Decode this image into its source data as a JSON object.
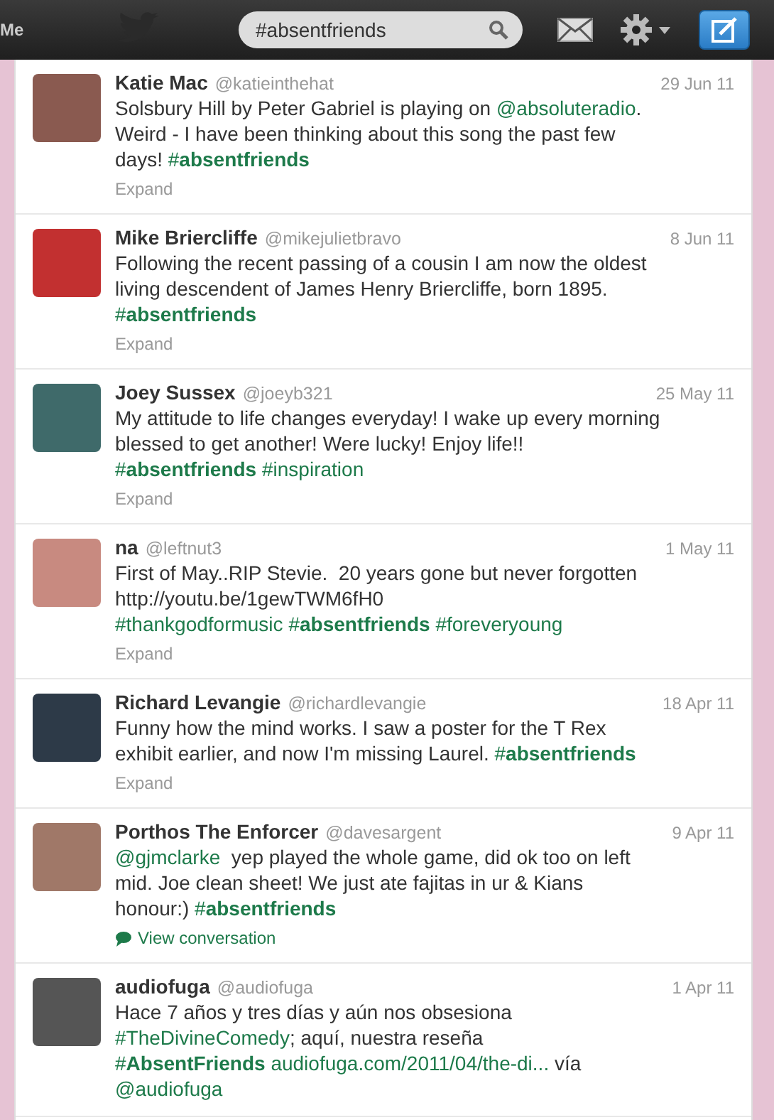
{
  "topbar": {
    "me_label": "Me",
    "search": {
      "value": "#absentfriends"
    }
  },
  "tweets": [
    {
      "name": "Katie Mac",
      "handle": "@katieinthehat",
      "date": "29 Jun 11",
      "body": [
        {
          "kind": "text",
          "text": "Solsbury Hill by Peter Gabriel is playing on "
        },
        {
          "kind": "mention",
          "text": "@absoluteradio"
        },
        {
          "kind": "text",
          "text": ". Weird - I have been thinking about this song the past few days! "
        },
        {
          "kind": "hashtag",
          "text": "#**absentfriends**"
        }
      ],
      "footer": {
        "kind": "expand",
        "text": "Expand"
      }
    },
    {
      "name": "Mike Briercliffe",
      "handle": "@mikejulietbravo",
      "date": "8 Jun 11",
      "body": [
        {
          "kind": "text",
          "text": "Following the recent passing of a cousin I am now the oldest living descendent of James Henry Briercliffe, born 1895. "
        },
        {
          "kind": "hashtag",
          "text": "#**absentfriends**"
        }
      ],
      "footer": {
        "kind": "expand",
        "text": "Expand"
      }
    },
    {
      "name": "Joey Sussex",
      "handle": "@joeyb321",
      "date": "25 May 11",
      "body": [
        {
          "kind": "text",
          "text": "My attitude to life changes everyday! I wake up every morning blessed to get another! Were lucky! Enjoy life!! "
        },
        {
          "kind": "hashtag",
          "text": "#**absentfriends** "
        },
        {
          "kind": "hashtag",
          "text": "#inspiration"
        }
      ],
      "footer": {
        "kind": "expand",
        "text": "Expand"
      }
    },
    {
      "name": "na",
      "handle": "@leftnut3",
      "date": "1 May 11",
      "body": [
        {
          "kind": "text",
          "text": "First of May..RIP Stevie.  20 years gone but never forgotten http://youtu.be/1gewTWM6fH0   "
        },
        {
          "kind": "hashtag",
          "text": "#thankgodformusic  "
        },
        {
          "kind": "hashtag",
          "text": "#**absentfriends** "
        },
        {
          "kind": "hashtag",
          "text": "#foreveryoung"
        }
      ],
      "footer": {
        "kind": "expand",
        "text": "Expand"
      }
    },
    {
      "name": "Richard Levangie",
      "handle": "@richardlevangie",
      "date": "18 Apr 11",
      "body": [
        {
          "kind": "text",
          "text": "Funny how the mind works. I saw a poster for the T Rex exhibit earlier, and now I'm missing Laurel. "
        },
        {
          "kind": "hashtag",
          "text": "#**absentfriends**"
        }
      ],
      "footer": {
        "kind": "expand",
        "text": "Expand"
      }
    },
    {
      "name": "Porthos The Enforcer",
      "handle": "@davesargent",
      "date": "9 Apr 11",
      "body": [
        {
          "kind": "mention",
          "text": "@gjmclarke"
        },
        {
          "kind": "text",
          "text": "  yep played the whole game, did ok too on left mid. Joe clean sheet! We just ate fajitas in ur & Kians honour:) "
        },
        {
          "kind": "hashtag",
          "text": "#**absentfriends**"
        }
      ],
      "footer": {
        "kind": "conversation",
        "text": "View conversation"
      }
    },
    {
      "name": "audiofuga",
      "handle": "@audiofuga",
      "date": "1 Apr 11",
      "body": [
        {
          "kind": "text",
          "text": "Hace 7 años y tres días y aún nos obsesiona "
        },
        {
          "kind": "hashtag",
          "text": "#TheDivineComedy"
        },
        {
          "kind": "text",
          "text": "; aquí, nuestra reseña "
        },
        {
          "kind": "hashtag",
          "text": "#**AbsentFriends** "
        },
        {
          "kind": "url",
          "text": "audiofuga.com/2011/04/the-di..."
        },
        {
          "kind": "text",
          "text": " vía "
        },
        {
          "kind": "mention",
          "text": "@audiofuga"
        }
      ]
    }
  ]
}
